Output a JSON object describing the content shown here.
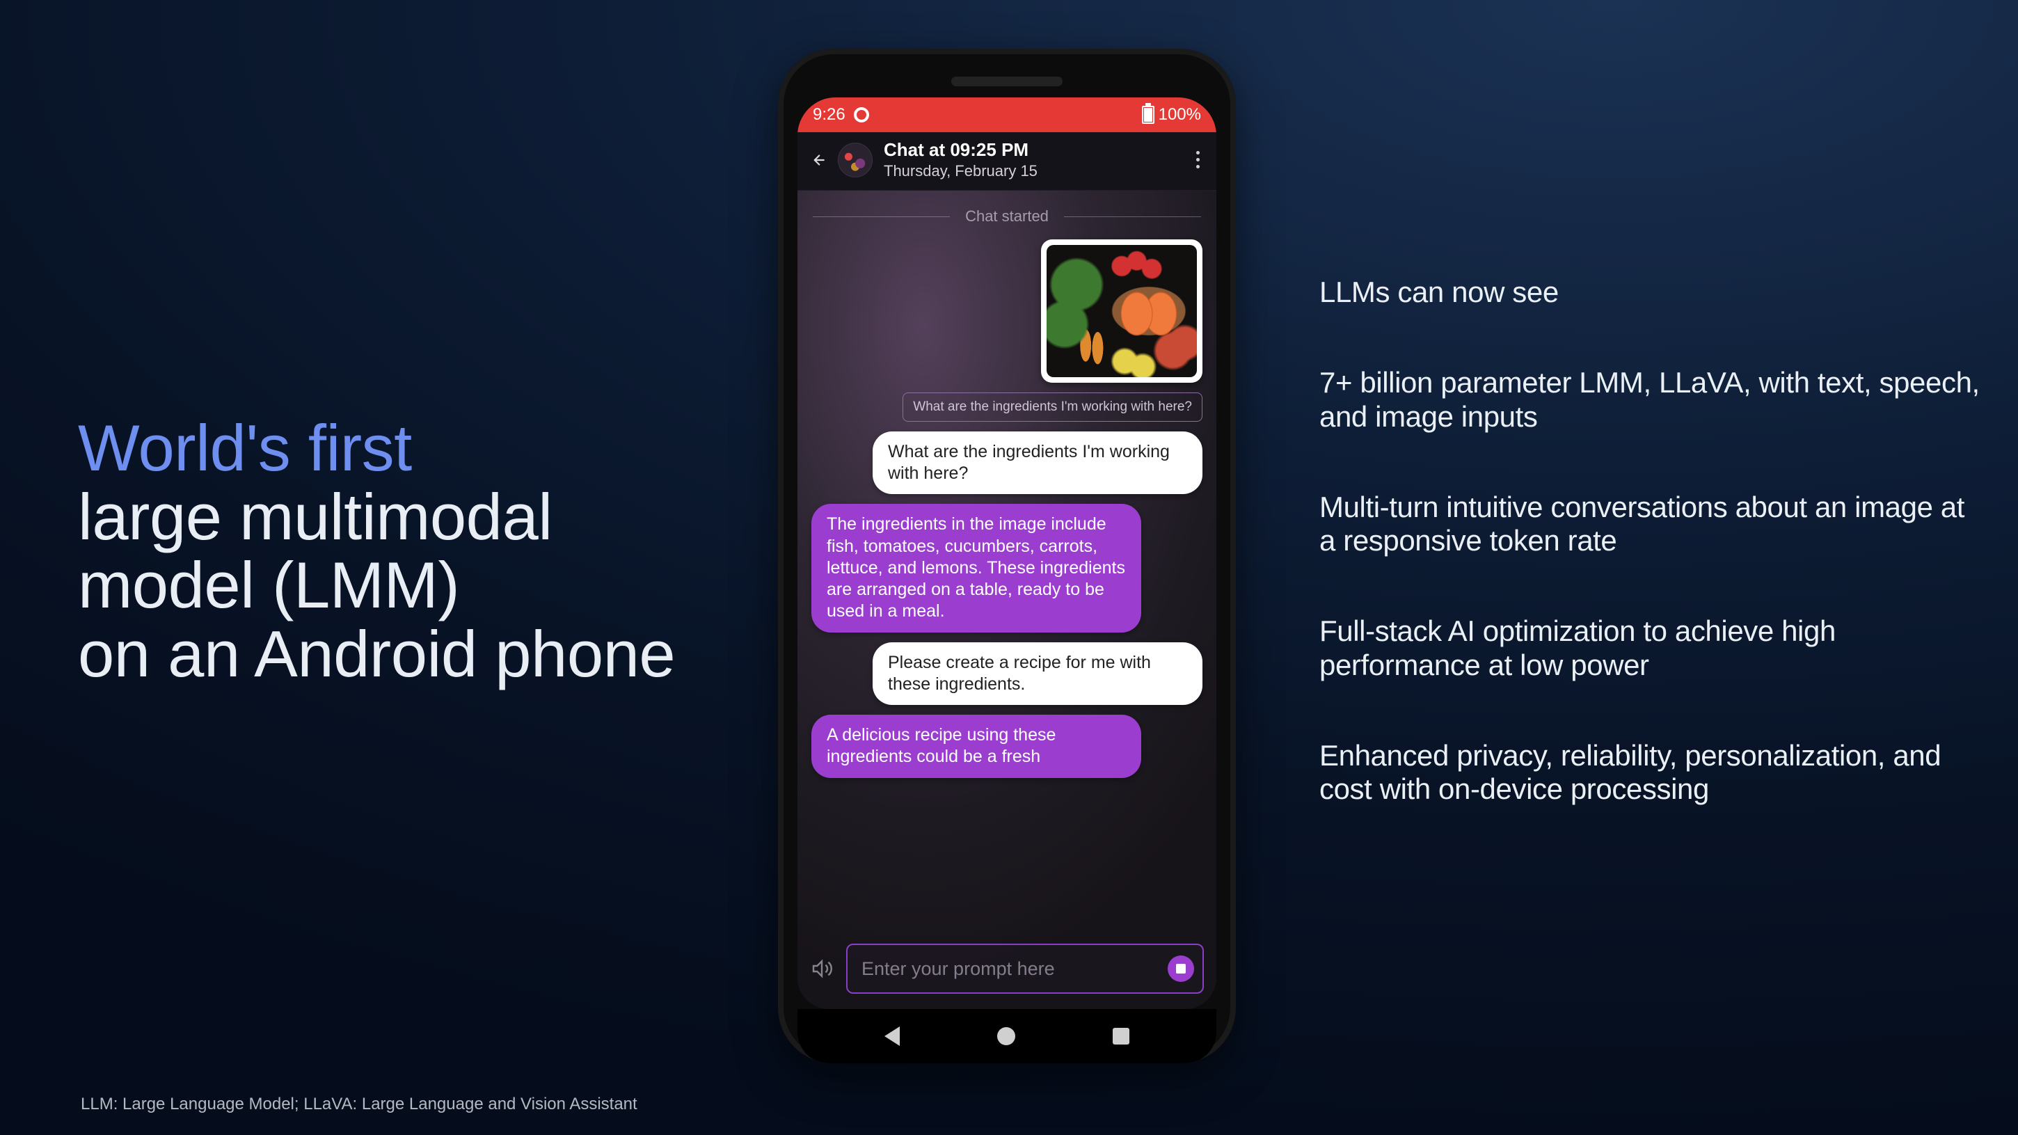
{
  "headline": {
    "line1": "World's first",
    "line2": "large multimodal",
    "line3": "model (LMM)",
    "line4": "on an Android phone"
  },
  "bullets": [
    "LLMs can now see",
    "7+ billion parameter LMM, LLaVA, with text, speech, and image inputs",
    "Multi-turn intuitive conversations about an image at a responsive token rate",
    "Full-stack AI optimization to achieve high performance at low power",
    "Enhanced privacy, reliability, personalization, and cost with on-device processing"
  ],
  "footnote": "LLM: Large Language Model; LLaVA: Large Language and Vision Assistant",
  "phone": {
    "status": {
      "time": "9:26",
      "battery": "100%"
    },
    "header": {
      "title": "Chat at 09:25 PM",
      "subtitle": "Thursday, February 15"
    },
    "chat": {
      "started_label": "Chat started",
      "user_query_mini": "What are the ingredients I'm working with here?",
      "user_query": "What are the ingredients I'm working with here?",
      "assistant_reply1": " The ingredients in the image include fish, tomatoes, cucumbers, carrots, lettuce, and lemons. These ingredients are arranged on a table, ready to be used in a meal.",
      "user_followup": "Please create a recipe for me with these ingredients.",
      "assistant_reply2": " A delicious recipe using these ingredients could be a fresh"
    },
    "input": {
      "placeholder": "Enter your prompt here"
    }
  }
}
